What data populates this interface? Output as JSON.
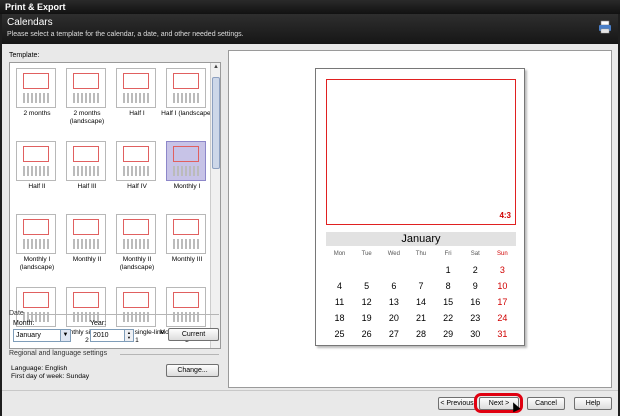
{
  "window": {
    "title": "Print & Export",
    "close_glyph": "✕"
  },
  "header": {
    "title": "Calendars",
    "subtitle": "Please select a template for the calendar, a date, and other needed settings.",
    "icon": "printer-icon"
  },
  "templates": {
    "label": "Template:",
    "selected": "Monthly I",
    "items": [
      {
        "name": "2 months"
      },
      {
        "name": "2 months (landscape)"
      },
      {
        "name": "Half I"
      },
      {
        "name": "Half I (landscape)"
      },
      {
        "name": "Half II"
      },
      {
        "name": "Half III"
      },
      {
        "name": "Half IV"
      },
      {
        "name": "Monthly I"
      },
      {
        "name": "Monthly I (landscape)"
      },
      {
        "name": "Monthly II"
      },
      {
        "name": "Monthly II (landscape)"
      },
      {
        "name": "Monthly III"
      },
      {
        "name": "Monthly sand"
      },
      {
        "name": "Monthly singe-line 2"
      },
      {
        "name": "Monthly single-line 1"
      },
      {
        "name": "Monthly single-line 3"
      }
    ]
  },
  "date": {
    "group_label": "Date",
    "month_label": "Month:",
    "month_value": "January",
    "year_label": "Year:",
    "year_value": "2010",
    "current_button": "Current"
  },
  "regional": {
    "group_label": "Regional and language settings",
    "language": "Language: English",
    "first_day": "First day of week: Sunday",
    "change_button": "Change..."
  },
  "preview": {
    "ratio": "4:3",
    "month": "January",
    "weekdays": [
      "Mon",
      "Tue",
      "Wed",
      "Thu",
      "Fri",
      "Sat",
      "Sun"
    ],
    "weeks": [
      [
        "",
        "",
        "",
        "",
        "1",
        "2",
        "3"
      ],
      [
        "4",
        "5",
        "6",
        "7",
        "8",
        "9",
        "10"
      ],
      [
        "11",
        "12",
        "13",
        "14",
        "15",
        "16",
        "17"
      ],
      [
        "18",
        "19",
        "20",
        "21",
        "22",
        "23",
        "24"
      ],
      [
        "25",
        "26",
        "27",
        "28",
        "29",
        "30",
        "31"
      ]
    ]
  },
  "footer": {
    "previous": "< Previous",
    "next": "Next >",
    "cancel": "Cancel",
    "help": "Help"
  },
  "colors": {
    "accent_red": "#d00000",
    "selected_template": "#c7c3e7",
    "titlebar": "#1e1e1e"
  }
}
